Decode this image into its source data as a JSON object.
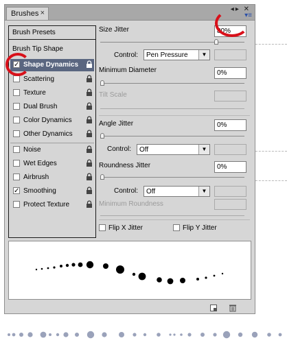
{
  "panel": {
    "tab_label": "Brushes",
    "close_glyph": "×",
    "window_buttons": "◂▸ ✕",
    "menu_glyph": "▾≡"
  },
  "left": {
    "presets_label": "Brush Presets",
    "tip_shape_label": "Brush Tip Shape",
    "options": [
      {
        "label": "Shape Dynamics",
        "checked": true,
        "selected": true,
        "icon": "lock-icon"
      },
      {
        "label": "Scattering",
        "checked": false,
        "icon": "lock-icon"
      },
      {
        "label": "Texture",
        "checked": false,
        "icon": "lock-icon"
      },
      {
        "label": "Dual Brush",
        "checked": false,
        "icon": "lock-icon"
      },
      {
        "label": "Color Dynamics",
        "checked": false,
        "icon": "lock-icon"
      },
      {
        "label": "Other Dynamics",
        "checked": false,
        "icon": "lock-icon"
      },
      {
        "label": "Noise",
        "checked": false,
        "icon": "lock-icon"
      },
      {
        "label": "Wet Edges",
        "checked": false,
        "icon": "lock-icon"
      },
      {
        "label": "Airbrush",
        "checked": false,
        "icon": "lock-icon"
      },
      {
        "label": "Smoothing",
        "checked": true,
        "icon": "lock-icon"
      },
      {
        "label": "Protect Texture",
        "checked": false,
        "icon": "lock-icon"
      }
    ]
  },
  "settings": {
    "size_jitter": {
      "label": "Size Jitter",
      "value": "80%",
      "slider_level": 0.8
    },
    "size_control": {
      "label": "Control:",
      "value": "Pen Pressure"
    },
    "min_diameter": {
      "label": "Minimum Diameter",
      "value": "0%",
      "slider_level": 0
    },
    "tilt_scale": {
      "label": "Tilt Scale"
    },
    "angle_jitter": {
      "label": "Angle Jitter",
      "value": "0%",
      "slider_level": 0
    },
    "angle_control": {
      "label": "Control:",
      "value": "Off"
    },
    "roundness_jitter": {
      "label": "Roundness Jitter",
      "value": "0%",
      "slider_level": 0
    },
    "roundness_control": {
      "label": "Control:",
      "value": "Off"
    },
    "min_roundness": {
      "label": "Minimum Roundness"
    },
    "flip_x": {
      "label": "Flip X Jitter",
      "checked": false
    },
    "flip_y": {
      "label": "Flip Y Jitter",
      "checked": false
    }
  },
  "footer": {
    "icons": [
      "new-preset-icon",
      "trash-icon"
    ]
  },
  "colors": {
    "annotation_ring": "#d8101a",
    "selected_row": "#5a6680",
    "panel_bg": "#d6d6d6"
  }
}
